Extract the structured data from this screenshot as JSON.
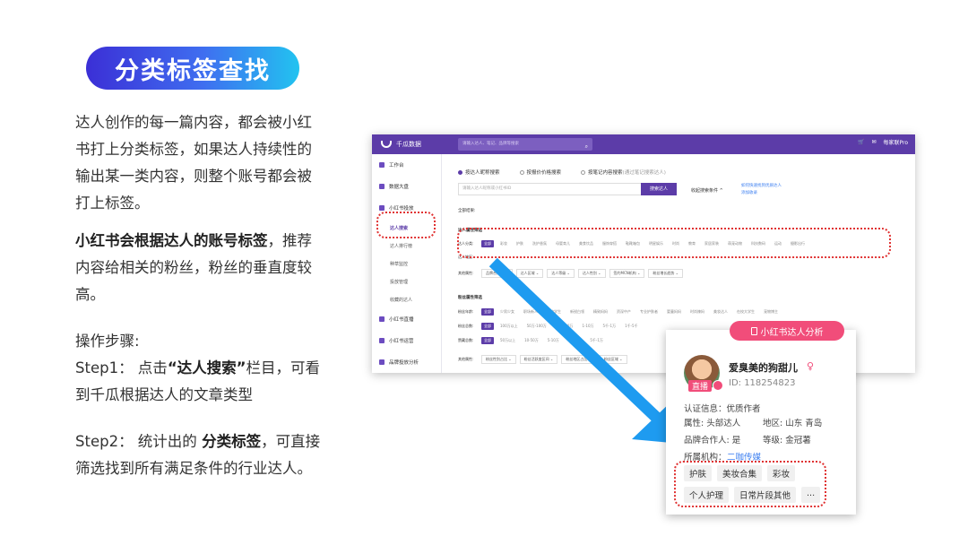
{
  "title": "分类标签查找",
  "paragraphs": {
    "p1": "达人创作的每一篇内容，都会被小红书打上分类标签，如果达人持续性的输出某一类内容，则整个账号都会被打上标签。",
    "p2_bold": "小红书会根据达人的账号标签",
    "p2_rest": "，推荐内容给相关的粉丝，粉丝的垂直度较高。",
    "p3_line1": "操作步骤:",
    "p3_step1_a": "Step1： 点击",
    "p3_step1_bold": "“达人搜索”",
    "p3_step1_b": "栏目，可看到千瓜根据达人的文章类型",
    "p4_a": "Step2： 统计出的 ",
    "p4_bold": "分类标签",
    "p4_b": "，可直接筛选找到所有满足条件的行业达人。"
  },
  "app": {
    "logo": "千瓜数据",
    "search_placeholder": "请输入达人、笔记、品牌等搜索",
    "user": "每家联Pro",
    "sidebar": [
      {
        "label": "工作台"
      },
      {
        "label": "数据大盘"
      },
      {
        "label": "小红书投放"
      }
    ],
    "sidebar_sub": [
      "达人搜索",
      "达人排行榜",
      "种草监控",
      "投放管理",
      "收藏的达人"
    ],
    "sidebar_bottom": [
      {
        "label": "小红书直播"
      },
      {
        "label": "小红书运营"
      },
      {
        "label": "品牌投放分析"
      }
    ],
    "radios": [
      "按达人昵称搜索",
      "按报价价格搜索",
      "按笔记内容搜索"
    ],
    "radio_hint": "(通过笔记搜索达人)",
    "input_placeholder": "请输入达人昵称或小红书ID",
    "search_btn": "搜索达人",
    "collapse": "收起搜索条件 ^",
    "help1": "如何快速找到优质达人",
    "help2": "添加收录",
    "all_results": "全部结果:",
    "sect1": "达人属性筛选",
    "row1_label": "达人分类:",
    "row1_chips": [
      "全部",
      "彩妆",
      "护肤",
      "洗护香氛",
      "母婴育儿",
      "美食饮品",
      "服饰穿搭",
      "鞋靴箱包",
      "明星娱乐",
      "时尚",
      "教育",
      "家居家装",
      "萌宠动物",
      "科技数码",
      "运动",
      "摄影出行"
    ],
    "row2_label": "达人地区:",
    "row3_label": "其他属性:",
    "row3_selects": [
      "品牌合作人",
      "达人区域",
      "达人等级",
      "达人性别",
      "签约MCN机构",
      "粉丝增长趋势"
    ],
    "sect2": "粉丝属性筛选",
    "row4_label": "粉丝年龄:",
    "row4_chips": [
      "全部",
      "少男少女",
      "职场新人",
      "高校学生",
      "新锐白领",
      "精致妈妈",
      "资深中产",
      "专业护肤者",
      "婴童妈妈",
      "时尚辣妈",
      "美妆达人",
      "在校大学生",
      "宠物博主"
    ],
    "row5_label": "粉丝总数:",
    "row5_chips": [
      "全部",
      "100万以上",
      "50万-100万",
      "10万-50万",
      "1-10万",
      "5千-1万",
      "1千-5千"
    ],
    "row6_label": "赞藏总数:",
    "row6_chips": [
      "全部",
      "50万以上",
      "10-50万",
      "5-10万",
      "1万-5万",
      "5千-1万"
    ],
    "row7_label": "其他属性:",
    "row7_selects": [
      "粉丝性别占比",
      "粉丝活跃度区间",
      "粉丝地区占比",
      "粉丝区域"
    ]
  },
  "card": {
    "tab": "小红书达人分析",
    "name": "爱臭美的狗甜儿",
    "id": "ID:  118254823",
    "live": "直播",
    "cert": "认证信息：优质作者",
    "attr": "属性: 头部达人",
    "region": "地区: 山东 青岛",
    "brand": "品牌合作人: 是",
    "level": "等级: 金冠薯",
    "org_label": "所属机构：",
    "org": "二咖传媒",
    "tags_row1": [
      "护肤",
      "美妆合集",
      "彩妆"
    ],
    "tags_row2": [
      "个人护理",
      "日常片段其他",
      "..."
    ]
  },
  "colors": {
    "accent": "#5c3ca8",
    "highlight": "#e03232",
    "arrow": "#1e9bf0",
    "pink": "#f14d7a"
  }
}
